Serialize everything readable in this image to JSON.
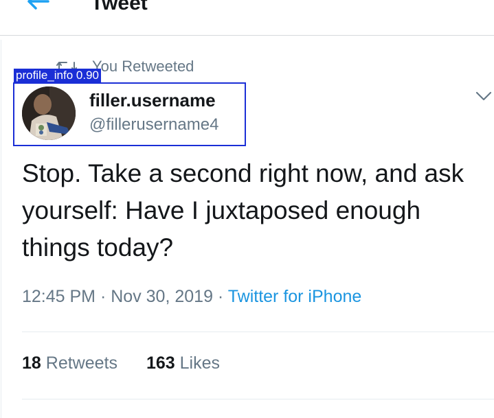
{
  "header": {
    "title": "Tweet",
    "back_icon": "back-arrow-icon"
  },
  "retweet_context": {
    "text": "You Retweeted",
    "icon": "retweet-icon"
  },
  "author": {
    "display_name": "filler.username",
    "handle": "@fillerusername4"
  },
  "detection_overlay": {
    "label": "profile_info 0.90",
    "color": "#1a2ed6"
  },
  "tweet": {
    "text": "Stop. Take a second right now, and ask yourself: Have I juxtaposed enough things today?",
    "time": "12:45 PM",
    "separator": "·",
    "date": "Nov 30, 2019",
    "source": "Twitter for iPhone"
  },
  "stats": {
    "retweets_count": "18",
    "retweets_label": "Retweets",
    "likes_count": "163",
    "likes_label": "Likes"
  },
  "colors": {
    "accent": "#1da1f2",
    "link": "#1b95e0",
    "secondary_text": "#657786"
  }
}
